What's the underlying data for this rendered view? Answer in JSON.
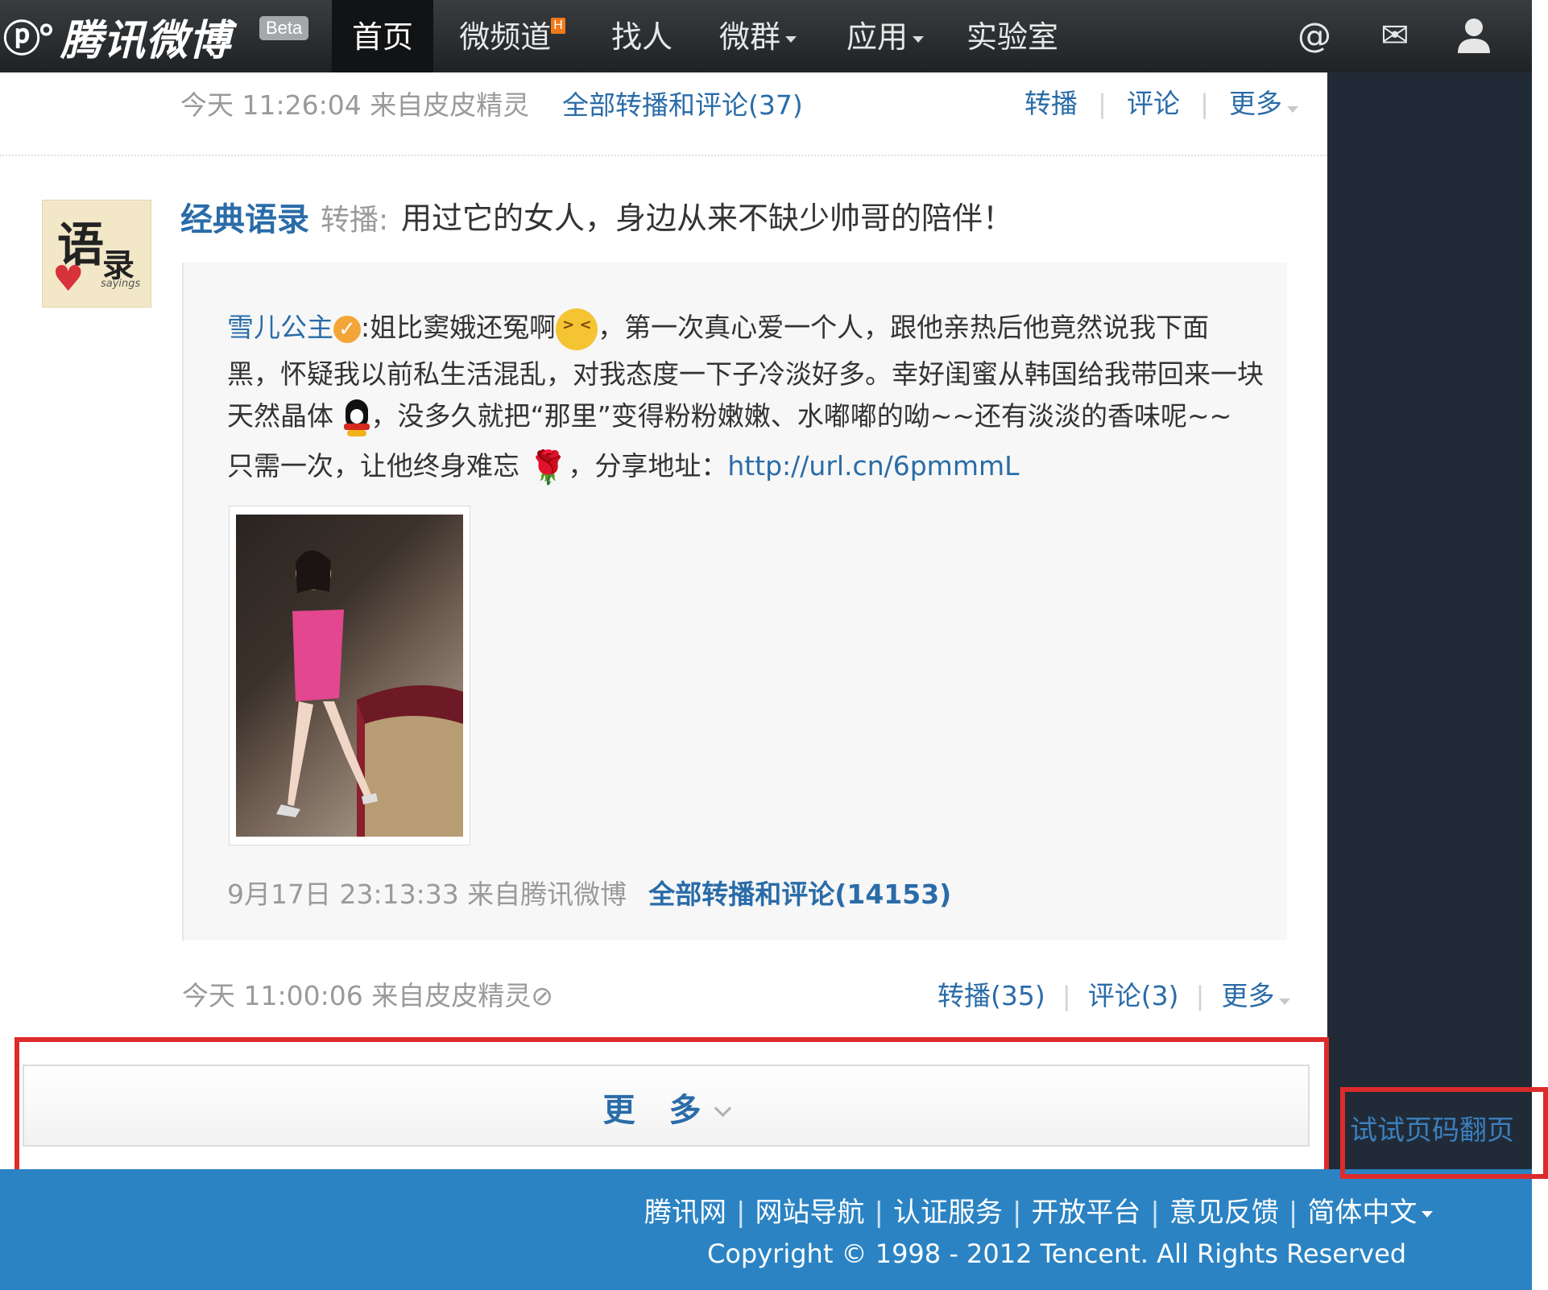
{
  "brand": {
    "name": "腾讯微博",
    "badge": "Beta"
  },
  "nav": {
    "items": [
      "首页",
      "微频道",
      "找人",
      "微群",
      "应用",
      "实验室"
    ],
    "active": "首页",
    "new_badge": "H"
  },
  "top_icons": [
    "at-icon",
    "mail-icon",
    "user-icon"
  ],
  "prev_post": {
    "time": "今天 11:26:04 来自皮皮精灵",
    "all_link": "全部转播和评论(37)",
    "repost": "转播",
    "comment": "评论",
    "more": "更多"
  },
  "post": {
    "author": "经典语录",
    "action": "转播:",
    "text": "用过它的女人，身边从来不缺少帅哥的陪伴！",
    "avatar": {
      "big_char": "语",
      "small_char": "录",
      "caption": "sayings"
    },
    "quoted": {
      "author": "雪儿公主",
      "verified_mark": "✓",
      "line1_a": "姐比窦娥还冤啊",
      "line1_b": "，第一次真心爱一个人，跟他亲热后他竟然说我下面",
      "line2": "黑，怀疑我以前私生活混乱，对我态度一下子冷淡好多。幸好闺蜜从韩国给我带回来一块",
      "line3_a": "天然晶体",
      "line3_b": "，没多久就把“那里”变得粉粉嫩嫩、水嘟嘟的呦~~还有淡淡的香味呢~~",
      "line4_a": "只需一次，让他终身难忘",
      "line4_b": "，分享地址：",
      "url": "http://url.cn/6pmmmL",
      "time": "9月17日 23:13:33 来自腾讯微博",
      "all_link": "全部转播和评论(14153)"
    },
    "meta": {
      "time": "今天 11:00:06 来自皮皮精灵",
      "blocked_icon": "⊘",
      "repost": "转播(35)",
      "comment": "评论(3)",
      "more": "更多"
    }
  },
  "more_button": "更 多",
  "try_paging": "试试页码翻页",
  "footer": {
    "links": [
      "腾讯网",
      "网站导航",
      "认证服务",
      "开放平台",
      "意见反馈",
      "简体中文"
    ],
    "copyright": "Copyright © 1998 - 2012 Tencent. All Rights Reserved"
  }
}
